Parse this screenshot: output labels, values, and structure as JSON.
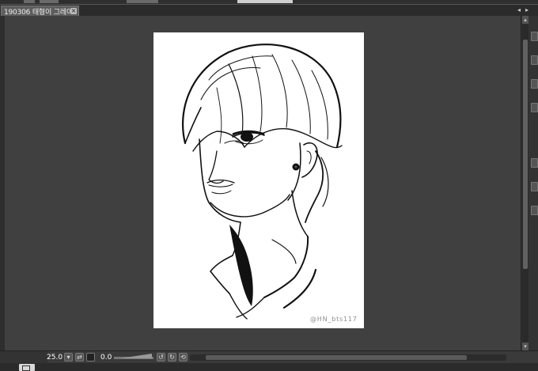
{
  "document_tab": {
    "title": "190306 태형이 그레이*",
    "close_symbol": "×"
  },
  "canvas": {
    "artwork": "pencil line drawing portrait",
    "watermark": "@HN_bts117",
    "paper_color": "#ffffff",
    "workspace_color": "#404040"
  },
  "status": {
    "zoom": "25.0",
    "rotation": "0.0",
    "zoom_step_icon": "chevron-icon",
    "flip_icon": "flip-icon",
    "rotate_left_icon": "rotate-left-icon",
    "rotate_right_icon": "rotate-right-icon",
    "reset_icon": "reset-icon"
  }
}
